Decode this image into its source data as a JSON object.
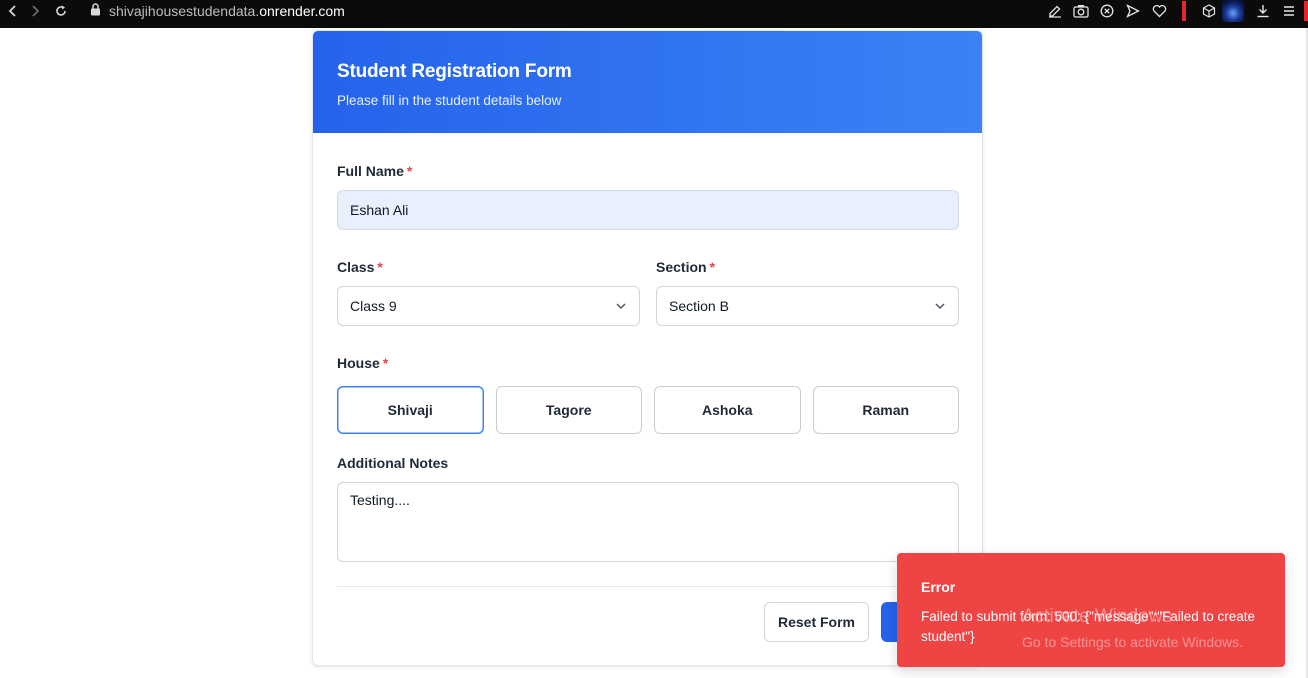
{
  "browser": {
    "url_host_prefix": "shivajihousestudendata.",
    "url_host_domain": "onrender.com"
  },
  "form": {
    "title": "Student Registration Form",
    "subtitle": "Please fill in the student details below",
    "full_name": {
      "label": "Full Name",
      "required_mark": "*",
      "value": "Eshan Ali"
    },
    "class": {
      "label": "Class",
      "required_mark": "*",
      "value": "Class 9"
    },
    "section": {
      "label": "Section",
      "required_mark": "*",
      "value": "Section B"
    },
    "house": {
      "label": "House",
      "required_mark": "*",
      "options": [
        "Shivaji",
        "Tagore",
        "Ashoka",
        "Raman"
      ],
      "selected": "Shivaji"
    },
    "notes": {
      "label": "Additional Notes",
      "value": "Testing...."
    },
    "reset_label": "Reset Form"
  },
  "toast": {
    "title": "Error",
    "message": "Failed to submit form: 500: {\"message\":\"Failed to create student\"}"
  },
  "watermark": {
    "title": "Activate Windows",
    "subtitle": "Go to Settings to activate Windows."
  },
  "colors": {
    "header_gradient_start": "#2563eb",
    "header_gradient_end": "#3b82f6",
    "required": "#ef4444",
    "toast_bg": "#ef4444",
    "selected_border": "#3b82f6",
    "input_fill": "#e8f0fe"
  }
}
